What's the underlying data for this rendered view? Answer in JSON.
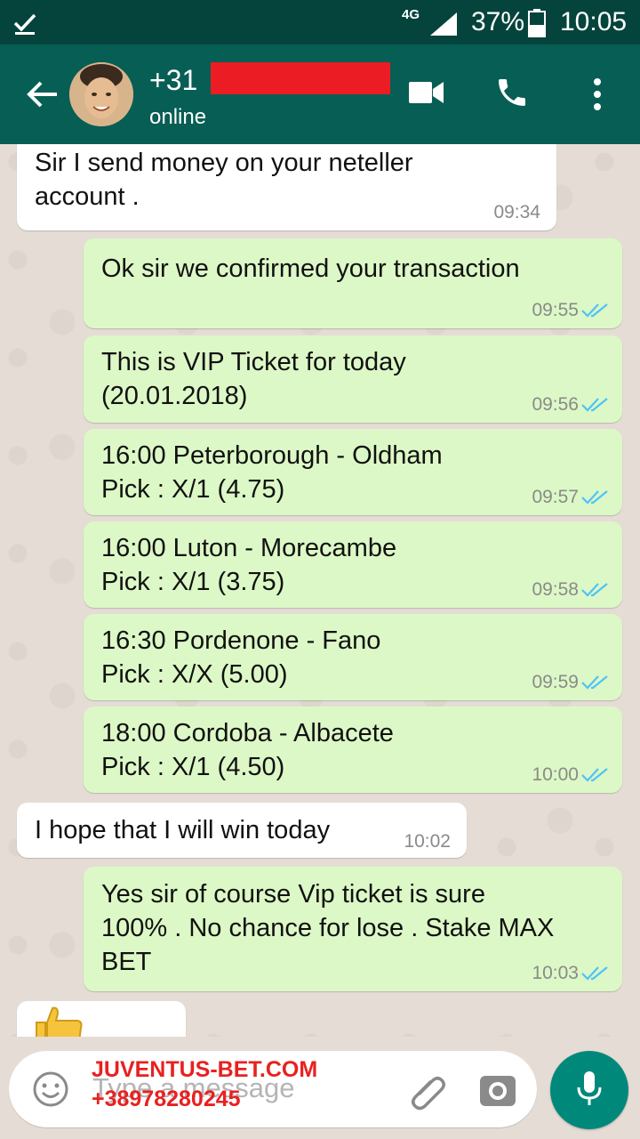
{
  "status_bar": {
    "network": "4G",
    "battery_percent": "37%",
    "time": "10:05"
  },
  "header": {
    "contact_name": "+31",
    "contact_status": "online"
  },
  "messages": [
    {
      "direction": "in",
      "text": "Sir I send money on your neteller\naccount .",
      "time": "09:34"
    },
    {
      "direction": "out",
      "text": "Ok sir we confirmed your transaction",
      "time": "09:55"
    },
    {
      "direction": "out",
      "text": "This is VIP Ticket for today\n(20.01.2018)",
      "time": "09:56"
    },
    {
      "direction": "out",
      "text": "16:00 Peterborough - Oldham\nPick : X/1 (4.75)",
      "time": "09:57"
    },
    {
      "direction": "out",
      "text": "16:00 Luton - Morecambe\nPick : X/1 (3.75)",
      "time": "09:58"
    },
    {
      "direction": "out",
      "text": "16:30 Pordenone - Fano\nPick : X/X (5.00)",
      "time": "09:59"
    },
    {
      "direction": "out",
      "text": "18:00 Cordoba - Albacete\nPick : X/1 (4.50)",
      "time": "10:00"
    },
    {
      "direction": "in",
      "text": "I hope that I will win today",
      "time": "10:02"
    },
    {
      "direction": "out",
      "text": "Yes sir of course Vip ticket is sure\n100% . No chance for lose . Stake MAX\nBET",
      "time": "10:03"
    }
  ],
  "input": {
    "placeholder": "Type a message"
  },
  "watermark": {
    "line1": "JUVENTUS-BET.COM",
    "line2": "+38978280245"
  },
  "colors": {
    "header": "#075e54",
    "status_bar": "#05443c",
    "outgoing_bubble": "#dcf8c6",
    "incoming_bubble": "#ffffff",
    "read_ticks": "#4fc3f7",
    "mic_button": "#00897b",
    "watermark": "#e8211f"
  },
  "icons": {
    "back": "arrow-left-icon",
    "video": "videocam-icon",
    "call": "phone-icon",
    "menu": "more-vert-icon",
    "emoji": "smiley-icon",
    "attach": "paperclip-icon",
    "camera": "camera-icon",
    "mic": "mic-icon",
    "reaction": "thumbs-up-icon"
  }
}
